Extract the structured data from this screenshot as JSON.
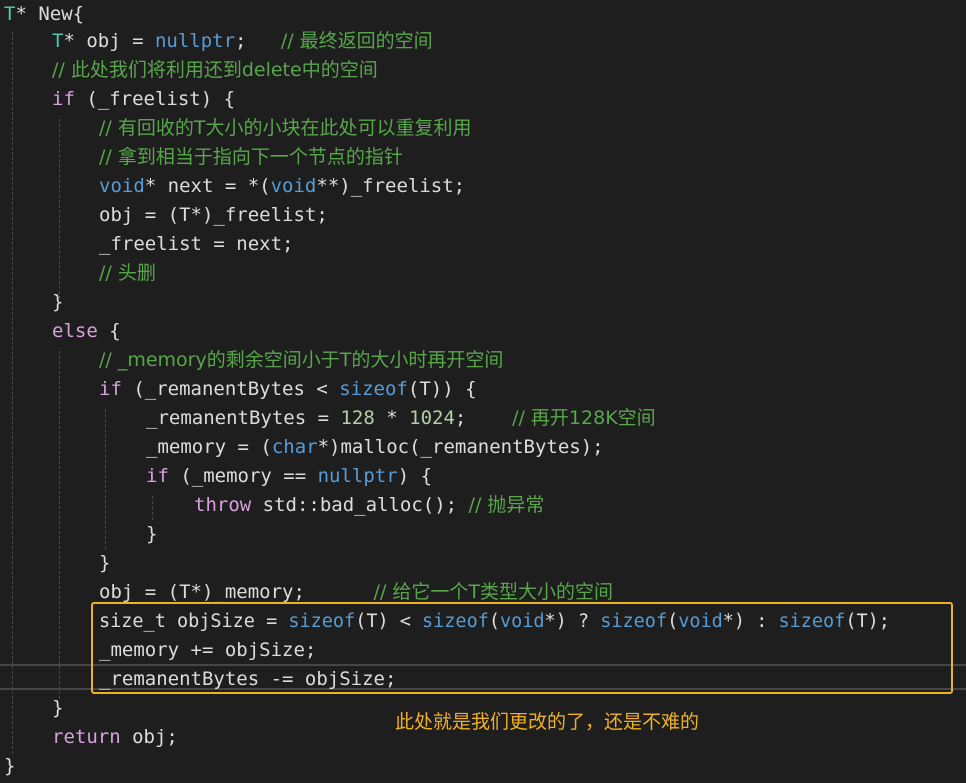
{
  "code": {
    "l1": {
      "type": "T",
      "rest": "* New{"
    },
    "l2": {
      "type": "T",
      "p1": "* obj = ",
      "kw": "nullptr",
      "p2": ";   ",
      "comment": "// 最终返回的空间"
    },
    "l3": {
      "comment": "// 此处我们将利用还到delete中的空间"
    },
    "l4": {
      "kw": "if",
      "rest": " (_freelist) {"
    },
    "l5": {
      "comment": "// 有回收的T大小的小块在此处可以重复利用"
    },
    "l6": {
      "comment": "// 拿到相当于指向下一个节点的指针"
    },
    "l7": {
      "kw1": "void",
      "p1": "* next = *(",
      "kw2": "void",
      "p2": "**)_freelist;"
    },
    "l8": {
      "text": "obj = (T*)_freelist;"
    },
    "l9": {
      "text": "_freelist = next;"
    },
    "l10": {
      "comment": "// 头删"
    },
    "l11": {
      "text": "}"
    },
    "l12": {
      "kw": "else",
      "rest": " {"
    },
    "l13": {
      "comment": "// _memory的剩余空间小于T的大小时再开空间"
    },
    "l14": {
      "kw": "if",
      "p1": " (_remanentBytes < ",
      "kw2": "sizeof",
      "p2": "(T)) {"
    },
    "l15": {
      "p1": "_remanentBytes = ",
      "n1": "128",
      "p2": " * ",
      "n2": "1024",
      "p3": ";    ",
      "comment": "// 再开128K空间"
    },
    "l16": {
      "p1": "_memory = (",
      "kw": "char",
      "p2": "*)malloc(_remanentBytes);"
    },
    "l17": {
      "kw": "if",
      "p1": " (_memory == ",
      "kw2": "nullptr",
      "p2": ") {"
    },
    "l18": {
      "kw": "throw",
      "p1": " std::bad_alloc(); ",
      "comment": "// 抛异常"
    },
    "l19": {
      "text": "}"
    },
    "l20": {
      "text": "}"
    },
    "l21": {
      "p1": "obj = (T*)_memory;      ",
      "comment": "// 给它一个T类型大小的空间"
    },
    "l22": {
      "p1": "size_t objSize = ",
      "s1": "sizeof",
      "p2": "(T) < ",
      "s2": "sizeof",
      "p3": "(",
      "v1": "void",
      "p4": "*) ? ",
      "s3": "sizeof",
      "p5": "(",
      "v2": "void",
      "p6": "*) : ",
      "s4": "sizeof",
      "p7": "(T);"
    },
    "l23": {
      "text": "_memory += objSize;"
    },
    "l24": {
      "text": "_remanentBytes -= objSize;"
    },
    "l25": {
      "text": "}"
    },
    "l26": {
      "kw": "return",
      "rest": " obj;"
    },
    "l27": {
      "text": "}"
    }
  },
  "annotation": "此处就是我们更改的了，还是不难的",
  "colors": {
    "background": "#1e1e1e",
    "type": "#4ec9b0",
    "keyword": "#569cd6",
    "control": "#d8a0df",
    "comment": "#57a64a",
    "number": "#b5cea8",
    "text": "#dcdcdc",
    "highlight": "#f0b024"
  }
}
